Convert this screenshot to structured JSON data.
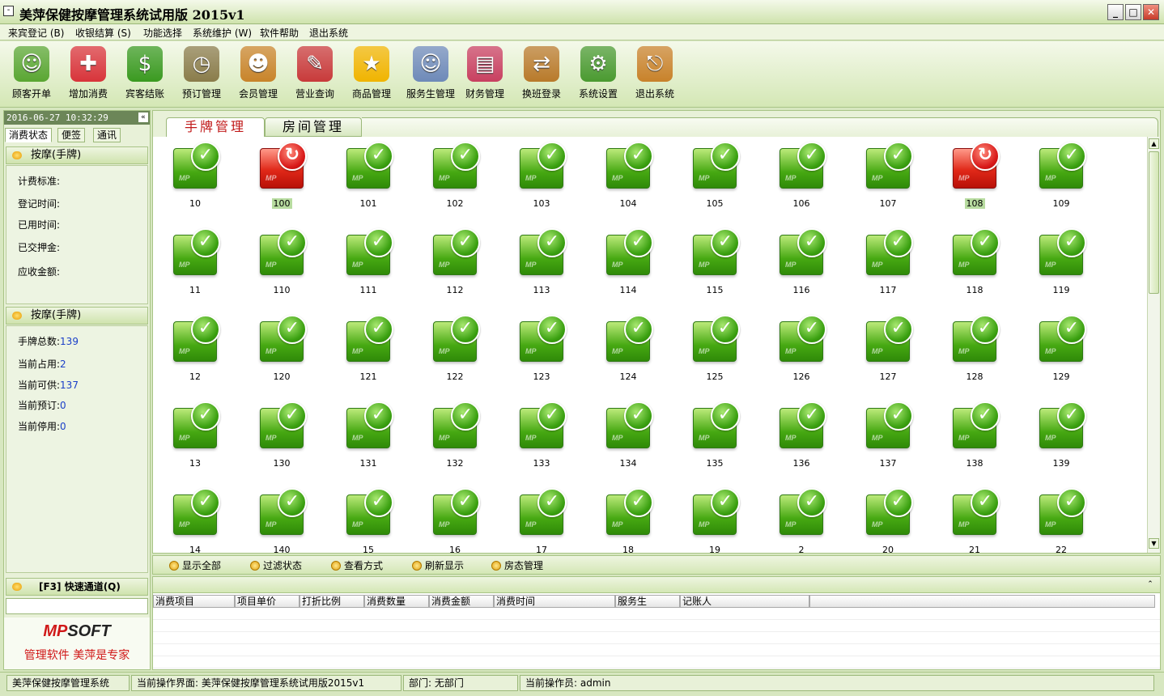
{
  "window": {
    "title": "美萍保健按摩管理系统试用版 2015v1",
    "controls": [
      "_",
      "□",
      "✕"
    ]
  },
  "menu": [
    "来宾登记 (B)",
    "收银结算 (S)",
    "功能选择",
    "系统维护 (W)",
    "软件帮助",
    "退出系统"
  ],
  "toolbar": [
    {
      "label": "顾客开单",
      "icon": "person-icon",
      "color": "#5aa632",
      "glyph": "☺"
    },
    {
      "label": "增加消费",
      "icon": "add-plus-icon",
      "color": "#d8343a",
      "glyph": "✚"
    },
    {
      "label": "宾客结账",
      "icon": "dollar-arrow-icon",
      "color": "#3a9a20",
      "glyph": "$"
    },
    {
      "label": "预订管理",
      "icon": "clock-icon",
      "color": "#8a7c4a",
      "glyph": "◷"
    },
    {
      "label": "会员管理",
      "icon": "members-icon",
      "color": "#c8842a",
      "glyph": "☻"
    },
    {
      "label": "营业查询",
      "icon": "book-search-icon",
      "color": "#c83a3a",
      "glyph": "✎"
    },
    {
      "label": "商品管理",
      "icon": "star-icon",
      "color": "#f0b400",
      "glyph": "★"
    },
    {
      "label": "服务生管理",
      "icon": "staff-group-icon",
      "color": "#6e8ab8",
      "glyph": "☺"
    },
    {
      "label": "财务管理",
      "icon": "calculator-icon",
      "color": "#c84060",
      "glyph": "▤"
    },
    {
      "label": "换班登录",
      "icon": "exit-door-person-icon",
      "color": "#b87a2a",
      "glyph": "⇄"
    },
    {
      "label": "系统设置",
      "icon": "gear-icon",
      "color": "#4a9a30",
      "glyph": "⚙"
    },
    {
      "label": "退出系统",
      "icon": "exit-door-icon",
      "color": "#c8822a",
      "glyph": "⎋"
    }
  ],
  "left": {
    "datetime": "2016-06-27 10:32:29",
    "collapse": "«",
    "tabs": [
      "消费状态",
      "便签",
      "通讯"
    ],
    "section1": {
      "title": "按摩(手牌)",
      "fields": [
        "计费标准:",
        "登记时间:",
        "已用时间:",
        "已交押金:",
        "应收金额:"
      ]
    },
    "section2": {
      "title": "按摩(手牌)",
      "fields": [
        {
          "label": "手牌总数:",
          "value": "139"
        },
        {
          "label": "当前占用:",
          "value": "2"
        },
        {
          "label": "当前可供:",
          "value": "137"
        },
        {
          "label": "当前预订:",
          "value": "0"
        },
        {
          "label": "当前停用:",
          "value": "0"
        }
      ]
    },
    "quick": "[F3] 快速通道(Q)",
    "brand": {
      "logo_mp": "MP",
      "logo_rest": "SOFT",
      "slogan": "管理软件  美萍是专家"
    }
  },
  "main": {
    "tabs": [
      "手牌管理",
      "房间管理"
    ],
    "cards": [
      {
        "num": "10",
        "busy": false
      },
      {
        "num": "100",
        "busy": true
      },
      {
        "num": "101",
        "busy": false
      },
      {
        "num": "102",
        "busy": false
      },
      {
        "num": "103",
        "busy": false
      },
      {
        "num": "104",
        "busy": false
      },
      {
        "num": "105",
        "busy": false
      },
      {
        "num": "106",
        "busy": false
      },
      {
        "num": "107",
        "busy": false
      },
      {
        "num": "108",
        "busy": true
      },
      {
        "num": "109",
        "busy": false
      },
      {
        "num": "11",
        "busy": false
      },
      {
        "num": "110",
        "busy": false
      },
      {
        "num": "111",
        "busy": false
      },
      {
        "num": "112",
        "busy": false
      },
      {
        "num": "113",
        "busy": false
      },
      {
        "num": "114",
        "busy": false
      },
      {
        "num": "115",
        "busy": false
      },
      {
        "num": "116",
        "busy": false
      },
      {
        "num": "117",
        "busy": false
      },
      {
        "num": "118",
        "busy": false
      },
      {
        "num": "119",
        "busy": false
      },
      {
        "num": "12",
        "busy": false
      },
      {
        "num": "120",
        "busy": false
      },
      {
        "num": "121",
        "busy": false
      },
      {
        "num": "122",
        "busy": false
      },
      {
        "num": "123",
        "busy": false
      },
      {
        "num": "124",
        "busy": false
      },
      {
        "num": "125",
        "busy": false
      },
      {
        "num": "126",
        "busy": false
      },
      {
        "num": "127",
        "busy": false
      },
      {
        "num": "128",
        "busy": false
      },
      {
        "num": "129",
        "busy": false
      },
      {
        "num": "13",
        "busy": false
      },
      {
        "num": "130",
        "busy": false
      },
      {
        "num": "131",
        "busy": false
      },
      {
        "num": "132",
        "busy": false
      },
      {
        "num": "133",
        "busy": false
      },
      {
        "num": "134",
        "busy": false
      },
      {
        "num": "135",
        "busy": false
      },
      {
        "num": "136",
        "busy": false
      },
      {
        "num": "137",
        "busy": false
      },
      {
        "num": "138",
        "busy": false
      },
      {
        "num": "139",
        "busy": false
      },
      {
        "num": "14",
        "busy": false
      },
      {
        "num": "140",
        "busy": false
      },
      {
        "num": "15",
        "busy": false
      },
      {
        "num": "16",
        "busy": false
      },
      {
        "num": "17",
        "busy": false
      },
      {
        "num": "18",
        "busy": false
      },
      {
        "num": "19",
        "busy": false
      },
      {
        "num": "2",
        "busy": false
      },
      {
        "num": "20",
        "busy": false
      },
      {
        "num": "21",
        "busy": false
      },
      {
        "num": "22",
        "busy": false
      }
    ],
    "card_logo": "MP",
    "status_glyphs": {
      "free": "✓",
      "busy": "↻"
    }
  },
  "actions": [
    "显示全部",
    "过滤状态",
    "查看方式",
    "刷新显示",
    "房态管理"
  ],
  "detail": {
    "collapse": "⌃",
    "columns": [
      "消费项目",
      "项目单价",
      "打折比例",
      "消费数量",
      "消费金额",
      "消费时间",
      "服务生",
      "记账人",
      ""
    ]
  },
  "status": [
    "美萍保健按摩管理系统",
    "当前操作界面: 美萍保健按摩管理系统试用版2015v1",
    "部门: 无部门",
    "当前操作员: admin"
  ]
}
